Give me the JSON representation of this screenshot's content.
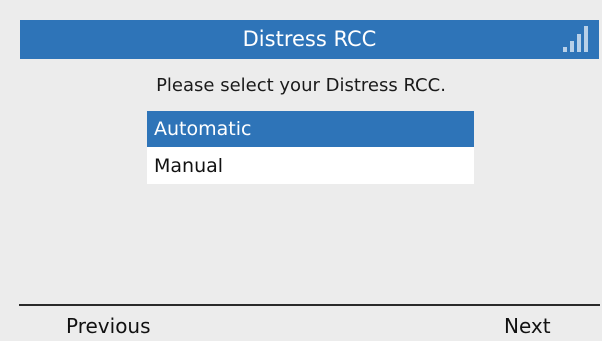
{
  "header": {
    "title": "Distress RCC",
    "status_icon": "signal-strength-icon"
  },
  "prompt": "Please select your Distress RCC.",
  "options": [
    {
      "label": "Automatic",
      "selected": true
    },
    {
      "label": "Manual",
      "selected": false
    }
  ],
  "softkeys": {
    "left": "Previous",
    "right": "Next"
  },
  "colors": {
    "accent": "#2e74b8",
    "background": "#ececec"
  }
}
